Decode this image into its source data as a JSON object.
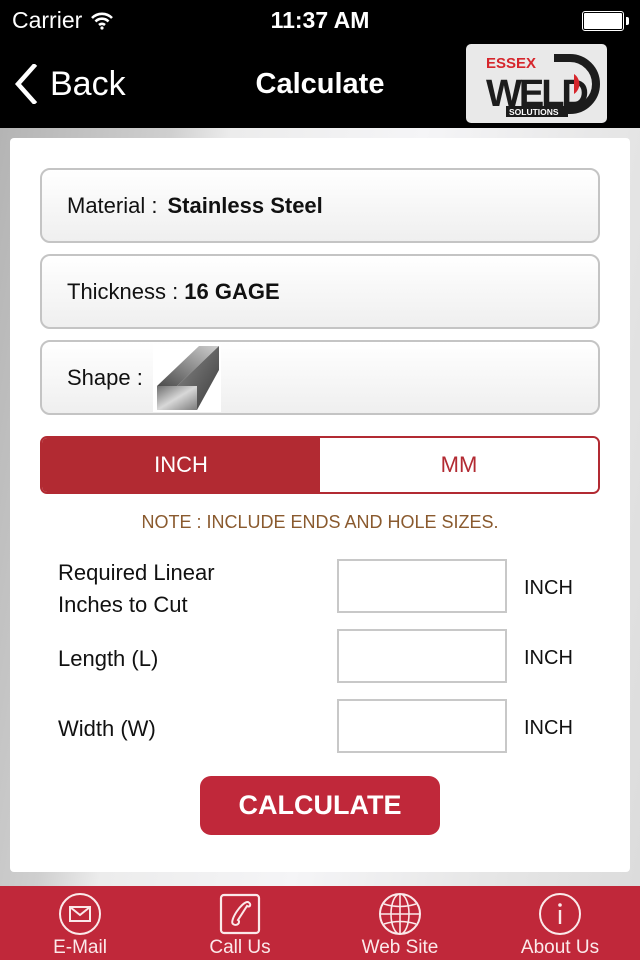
{
  "status_bar": {
    "carrier": "Carrier",
    "time": "11:37 AM",
    "wifi_icon": "wifi-icon",
    "battery_icon": "battery-full-icon"
  },
  "nav": {
    "back_label": "Back",
    "back_icon": "chevron-left-icon",
    "title": "Calculate",
    "logo": {
      "top_text": "ESSEX",
      "main_text": "WELD",
      "bottom_text": "SOLUTIONS"
    }
  },
  "form": {
    "material": {
      "label": "Material :",
      "value": "Stainless Steel"
    },
    "thickness": {
      "label": "Thickness :",
      "value": "16 GAGE"
    },
    "shape": {
      "label": "Shape :",
      "value_icon": "square-bar-icon"
    },
    "units": {
      "options": [
        "INCH",
        "MM"
      ],
      "selected": "INCH"
    },
    "note": "NOTE : INCLUDE ENDS AND HOLE SIZES.",
    "fields": [
      {
        "label_line1": "Required Linear",
        "label_line2": "Inches to Cut",
        "value": "",
        "unit": "INCH"
      },
      {
        "label": "Length (L)",
        "value": "",
        "unit": "INCH"
      },
      {
        "label": "Width (W)",
        "value": "",
        "unit": "INCH"
      }
    ],
    "calculate_label": "CALCULATE"
  },
  "tab_bar": {
    "items": [
      {
        "label": "E-Mail",
        "icon": "mail-icon"
      },
      {
        "label": "Call Us",
        "icon": "phone-icon"
      },
      {
        "label": "Web Site",
        "icon": "globe-icon"
      },
      {
        "label": "About Us",
        "icon": "info-icon"
      }
    ]
  },
  "colors": {
    "accent": "#c0283a",
    "segment_red": "#b22a32",
    "note_brown": "#8a5a2e",
    "nav_bg": "#000000"
  }
}
